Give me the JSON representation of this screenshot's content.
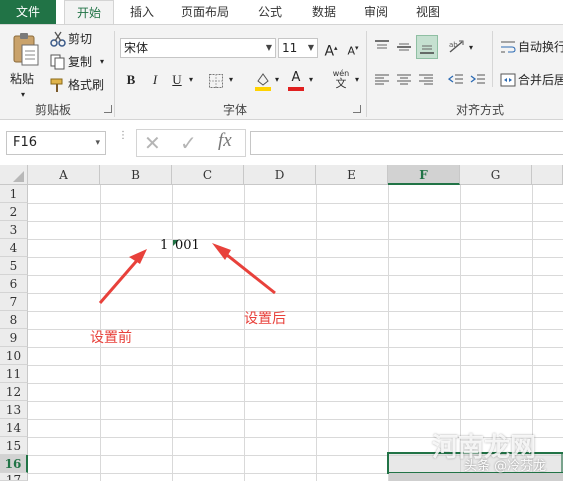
{
  "tabs": [
    "文件",
    "开始",
    "插入",
    "页面布局",
    "公式",
    "数据",
    "审阅",
    "视图"
  ],
  "clipboard": {
    "paste": "粘贴",
    "cut": "剪切",
    "copy": "复制",
    "format_painter": "格式刷",
    "group_label": "剪贴板"
  },
  "font": {
    "font_name": "宋体",
    "font_size": "11",
    "increase": "A",
    "decrease": "A",
    "bold": "B",
    "italic": "I",
    "underline": "U",
    "font_color_glyph": "A",
    "phonetic_top": "wén",
    "phonetic_bottom": "文",
    "group_label": "字体"
  },
  "alignment": {
    "wrap_text": "自动换行",
    "merge_center": "合并后居",
    "group_label": "对齐方式"
  },
  "formula_bar": {
    "name_box": "F16",
    "fx": "fx",
    "cancel": "✕",
    "enter": "✓"
  },
  "grid": {
    "columns": [
      "A",
      "B",
      "C",
      "D",
      "E",
      "F",
      "G"
    ],
    "selected_column": "F",
    "rows": [
      "1",
      "2",
      "3",
      "4",
      "5",
      "6",
      "7",
      "8",
      "9",
      "10",
      "11",
      "12",
      "13",
      "14",
      "15",
      "16",
      "17"
    ],
    "selected_row": "16",
    "cells": {
      "B4": "1",
      "C4": "001"
    }
  },
  "annotations": {
    "before": "设置前",
    "after": "设置后"
  },
  "watermark": {
    "site": "河南龙网",
    "author": "头条 @冷芬龙"
  },
  "colors": {
    "accent": "#217346",
    "annotation": "#e8413b"
  }
}
